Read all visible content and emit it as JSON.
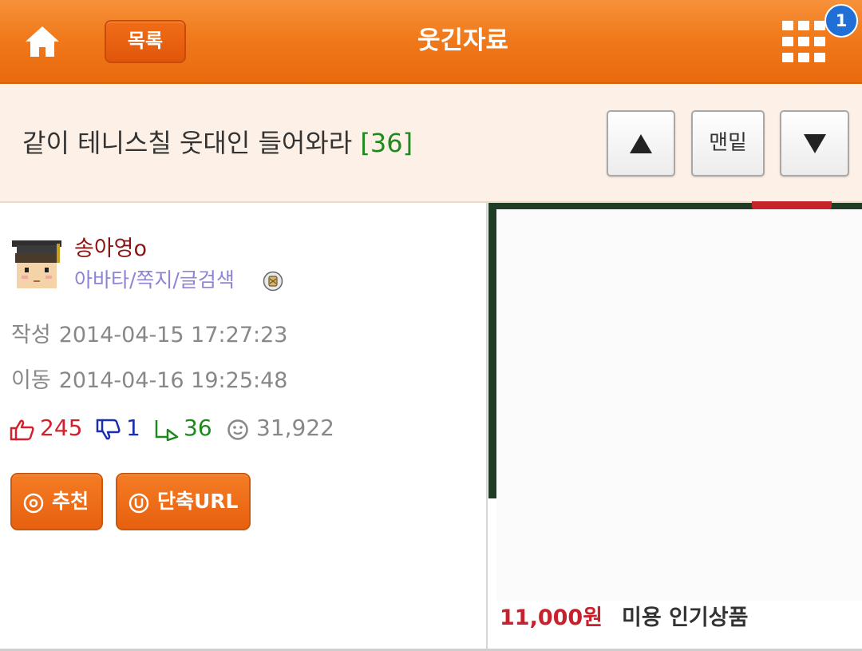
{
  "header": {
    "title": "웃긴자료",
    "list_button": "목록",
    "notification_count": "1",
    "bg_color": "#f07a1c"
  },
  "post": {
    "title": "같이 테니스칠 웃대인 들어와라",
    "comment_count": "[36]",
    "nav": {
      "up_icon": "triangle-up-icon",
      "bottom_label": "맨밑",
      "down_icon": "triangle-down-icon"
    }
  },
  "author": {
    "name": "송아영o",
    "links": "아바타/쪽지/글검색",
    "created_label": "작성",
    "created": "2014-04-15 17:27:23",
    "moved_label": "이동",
    "moved": "2014-04-16 19:25:48"
  },
  "stats": {
    "likes": "245",
    "dislikes": "1",
    "replies": "36",
    "views": "31,922",
    "like_color": "#d2202e",
    "dislike_color": "#1a2fb0",
    "reply_color": "#1d8a1d"
  },
  "actions": {
    "recommend": "추천",
    "short_url": "단축URL"
  },
  "ad": {
    "price": "11,000원",
    "name": "미용 인기상품"
  }
}
